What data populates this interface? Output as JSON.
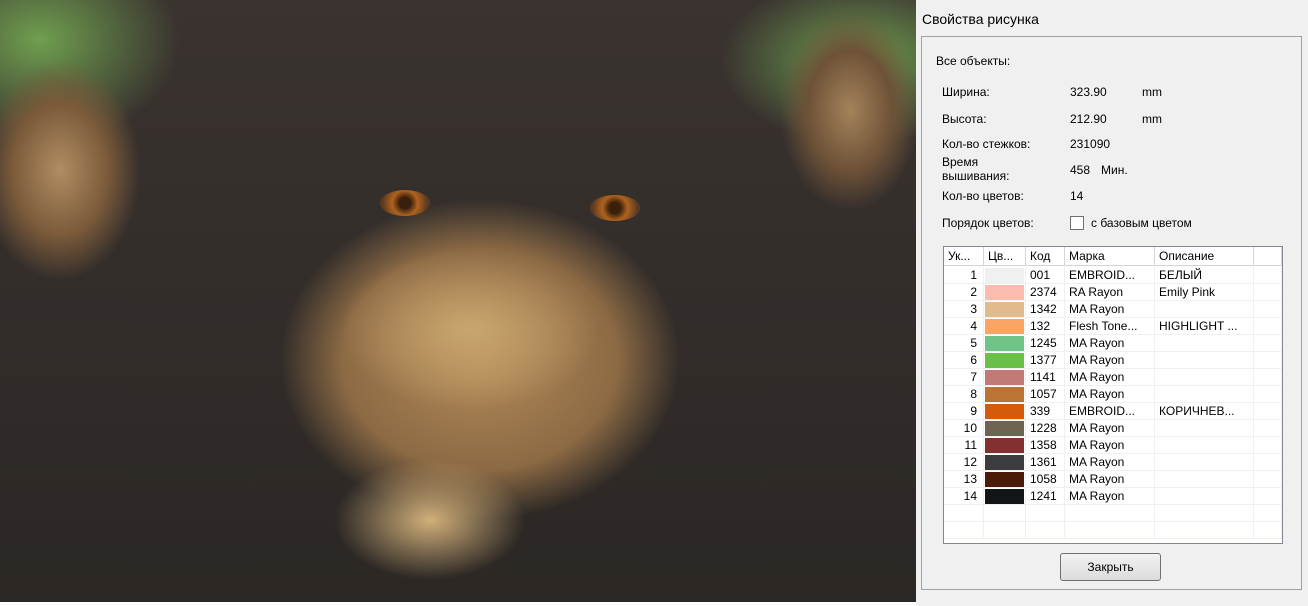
{
  "dialog": {
    "title": "Свойства рисунка",
    "all_objects": "Все объекты:",
    "width_label": "Ширина:",
    "width_value": "323.90",
    "width_unit": "mm",
    "height_label": "Высота:",
    "height_value": "212.90",
    "height_unit": "mm",
    "stitches_label": "Кол-во стежков:",
    "stitches_value": "231090",
    "time_label_1": "Время",
    "time_label_2": "вышивания:",
    "time_value": "458",
    "time_unit": "Мин.",
    "colors_label": "Кол-во цветов:",
    "colors_value": "14",
    "order_label": "Порядок цветов:",
    "base_color_checkbox": "с базовым цветом",
    "base_color_checked": false,
    "close_button": "Закрыть"
  },
  "table": {
    "headers": [
      "Ук...",
      "Цв...",
      "Код",
      "Марка",
      "Описание"
    ],
    "rows": [
      {
        "n": "1",
        "color": "#f0f0f0",
        "code": "001",
        "brand": "EMBROID...",
        "desc": "БЕЛЫЙ"
      },
      {
        "n": "2",
        "color": "#fbbcb0",
        "code": "2374",
        "brand": "RA Rayon",
        "desc": "Emily Pink"
      },
      {
        "n": "3",
        "color": "#e2bb8c",
        "code": "1342",
        "brand": "MA Rayon",
        "desc": ""
      },
      {
        "n": "4",
        "color": "#fba564",
        "code": "132",
        "brand": "Flesh Tone...",
        "desc": "HIGHLIGHT ..."
      },
      {
        "n": "5",
        "color": "#70c488",
        "code": "1245",
        "brand": "MA Rayon",
        "desc": ""
      },
      {
        "n": "6",
        "color": "#6abf48",
        "code": "1377",
        "brand": "MA Rayon",
        "desc": ""
      },
      {
        "n": "7",
        "color": "#c27a76",
        "code": "1141",
        "brand": "MA Rayon",
        "desc": ""
      },
      {
        "n": "8",
        "color": "#bc7434",
        "code": "1057",
        "brand": "MA Rayon",
        "desc": ""
      },
      {
        "n": "9",
        "color": "#d55a0c",
        "code": "339",
        "brand": "EMBROID...",
        "desc": "КОРИЧНЕВ..."
      },
      {
        "n": "10",
        "color": "#6e6452",
        "code": "1228",
        "brand": "MA Rayon",
        "desc": ""
      },
      {
        "n": "11",
        "color": "#833030",
        "code": "1358",
        "brand": "MA Rayon",
        "desc": ""
      },
      {
        "n": "12",
        "color": "#3c3c3e",
        "code": "1361",
        "brand": "MA Rayon",
        "desc": ""
      },
      {
        "n": "13",
        "color": "#4a1c08",
        "code": "1058",
        "brand": "MA Rayon",
        "desc": ""
      },
      {
        "n": "14",
        "color": "#121416",
        "code": "1241",
        "brand": "MA Rayon",
        "desc": ""
      }
    ]
  }
}
